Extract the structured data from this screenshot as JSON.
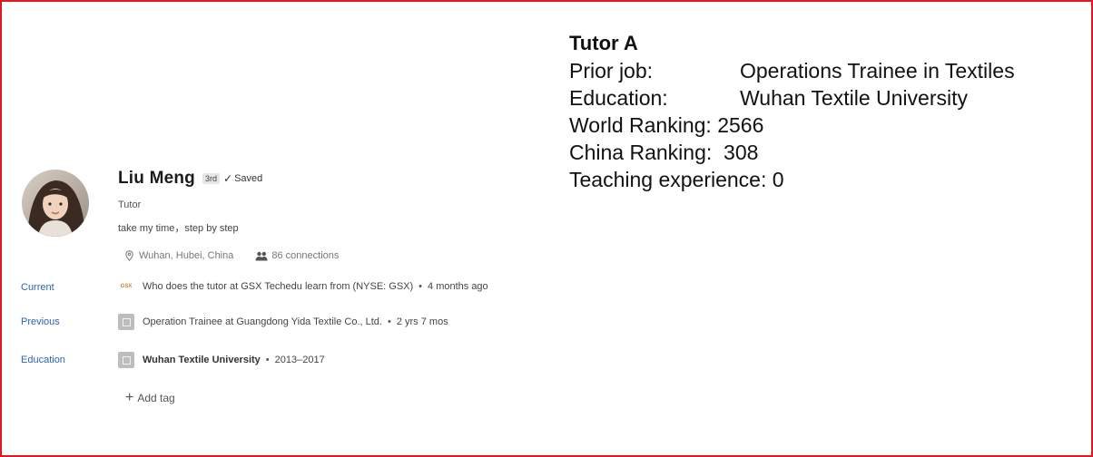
{
  "summary": {
    "title": "Tutor A",
    "rows": [
      {
        "label": "Prior job:",
        "value": "Operations Trainee in Textiles"
      },
      {
        "label": "Education:",
        "value": "Wuhan Textile University"
      },
      {
        "label": "World Ranking:",
        "value": "2566"
      },
      {
        "label": "China Ranking:",
        "value": "308"
      },
      {
        "label": "Teaching experience:",
        "value": "0"
      }
    ]
  },
  "profile": {
    "name": "Liu Meng",
    "degree": "3rd",
    "saved": "Saved",
    "headline": "Tutor",
    "tagline": "take my time，step by step",
    "location": "Wuhan, Hubei, China",
    "connections": "86 connections"
  },
  "sections": {
    "current": {
      "label": "Current",
      "text": "Who does the tutor at GSX Techedu learn from (NYSE: GSX)",
      "time": "4 months ago",
      "logo_text": "GSX"
    },
    "previous": {
      "label": "Previous",
      "text": "Operation Trainee at Guangdong Yida Textile Co., Ltd.",
      "time": "2 yrs 7 mos"
    },
    "education": {
      "label": "Education",
      "text": "Wuhan Textile University",
      "time": "2013–2017"
    }
  },
  "add_tag": "Add tag",
  "colors": {
    "frame": "#e0191e",
    "link": "#2a65b0"
  },
  "icons": {
    "location": "location-pin-icon",
    "connections": "people-icon",
    "check": "check-icon",
    "plus": "plus-icon"
  }
}
